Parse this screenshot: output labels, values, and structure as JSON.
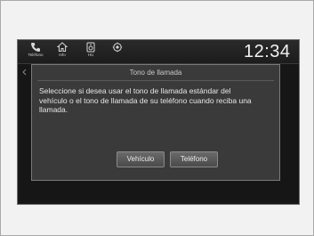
{
  "statusbar": {
    "items": [
      {
        "label": "Teléfono",
        "icon": "phone-icon"
      },
      {
        "label": "Info",
        "icon": "home-icon"
      },
      {
        "label": "HU",
        "icon": "sound-icon"
      },
      {
        "label": "",
        "icon": "settings-icon"
      }
    ],
    "clock_small": "",
    "clock": "12:34"
  },
  "dialog": {
    "title": "Tono de llamada",
    "message": "Seleccione si desea usar el tono de llamada estándar del\nvehículo o el tono de llamada de su teléfono cuando reciba una llamada.",
    "buttons": {
      "vehicle": "Vehículo",
      "phone": "Teléfono"
    }
  }
}
